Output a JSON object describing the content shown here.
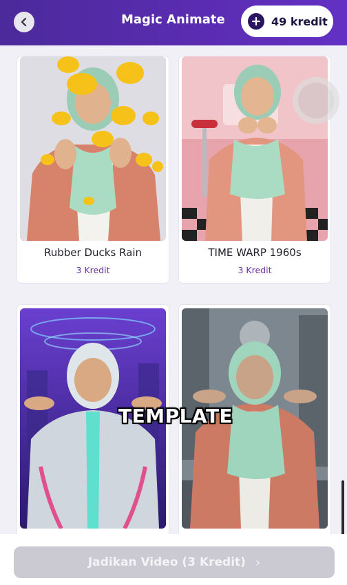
{
  "header": {
    "title": "Magic Animate",
    "credits": "49 kredit",
    "back_icon": "chevron-left-icon",
    "plus_icon": "plus-icon"
  },
  "templates": [
    {
      "name": "Rubber Ducks Rain",
      "credit": "3 Kredit"
    },
    {
      "name": "TIME WARP 1960s",
      "credit": "3 Kredit"
    },
    {
      "name": "",
      "credit": ""
    },
    {
      "name": "",
      "credit": ""
    }
  ],
  "overlay": {
    "text": "TEMPLATE"
  },
  "cta": {
    "label": "Jadikan Video (3 Kredit)",
    "icon": "chevron-right-icon"
  },
  "colors": {
    "header": "#5a2cb0",
    "credit_accent": "#6a2ea6",
    "cta_disabled": "#cbc9d1"
  }
}
